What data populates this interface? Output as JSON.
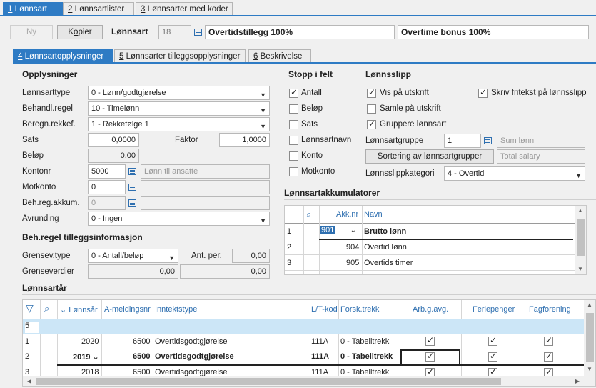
{
  "top_tabs": [
    {
      "num": "1",
      "label": " Lønnsart"
    },
    {
      "num": "2",
      "label": " Lønnsartlister"
    },
    {
      "num": "3",
      "label": " Lønnsarter med koder"
    }
  ],
  "header": {
    "new_label": "Ny",
    "copy_label": "Kopier",
    "copy_mnemonic": "o",
    "lonnsart_label": "Lønnsart",
    "lonnsart_id": "18",
    "name_no": "Overtidstillegg 100%",
    "name_en": "Overtime bonus 100%"
  },
  "sub_tabs": [
    {
      "num": "4",
      "label": " Lønnsartopplysninger"
    },
    {
      "num": "5",
      "label": " Lønnsarter tilleggsopplysninger"
    },
    {
      "num": "6",
      "label": " Beskrivelse"
    }
  ],
  "opplysninger": {
    "title": "Opplysninger",
    "lonnsarttype_label": "Lønnsarttype",
    "lonnsarttype_value": "0 - Lønn/godtgjørelse",
    "behandl_label": "Behandl.regel",
    "behandl_value": "10 - Timelønn",
    "beregn_label": "Beregn.rekkef.",
    "beregn_value": "1 - Rekkefølge 1",
    "sats_label": "Sats",
    "sats_value": "0,0000",
    "faktor_label": "Faktor",
    "faktor_value": "1,0000",
    "belop_label": "Beløp",
    "belop_value": "0,00",
    "kontonr_label": "Kontonr",
    "kontonr_value": "5000",
    "kontonr_desc": "Lønn til ansatte",
    "motkonto_label": "Motkonto",
    "motkonto_value": "0",
    "behreg_label": "Beh.reg.akkum.",
    "behreg_value": "0",
    "avrunding_label": "Avrunding",
    "avrunding_value": "0 - Ingen"
  },
  "behregel_info": {
    "title": "Beh.regel tilleggsinformasjon",
    "grensev_label": "Grensev.type",
    "grensev_value": "0 - Antall/beløp",
    "antper_label": "Ant. per.",
    "antper_value": "0,00",
    "grenseverdier_label": "Grenseverdier",
    "grense1": "0,00",
    "grense2": "0,00"
  },
  "stopp": {
    "title": "Stopp i felt",
    "items": [
      {
        "label": "Antall",
        "checked": true
      },
      {
        "label": "Beløp",
        "checked": false
      },
      {
        "label": "Sats",
        "checked": false
      },
      {
        "label": "Lønnsartnavn",
        "checked": false
      },
      {
        "label": "Konto",
        "checked": false
      },
      {
        "label": "Motkonto",
        "checked": false
      }
    ]
  },
  "lonnsslipp": {
    "title": "Lønnsslipp",
    "vis_label": "Vis på utskrift",
    "skriv_label": "Skriv fritekst på lønnsslipp",
    "samle_label": "Samle på utskrift",
    "gruppere_label": "Gruppere lønnsart",
    "gruppe_label": "Lønnsartgruppe",
    "gruppe_value": "1",
    "gruppe_desc": "Sum lønn",
    "sortering_label": "Sortering av lønnsartgrupper",
    "total_desc": "Total salary",
    "kategori_label": "Lønnsslippkategori",
    "kategori_value": "4 - Overtid"
  },
  "akkumulatorer": {
    "title": "Lønnsartakkumulatorer",
    "col_akknr": "Akk.nr",
    "col_navn": "Navn",
    "rows": [
      {
        "n": "1",
        "akk": "901",
        "navn": "Brutto lønn"
      },
      {
        "n": "2",
        "akk": "904",
        "navn": "Overtid lønn"
      },
      {
        "n": "3",
        "akk": "905",
        "navn": "Overtids timer"
      }
    ]
  },
  "lonnsartar": {
    "title": "Lønnsartår",
    "cols": [
      "Lønnsår",
      "A-meldingsnr",
      "Inntektstype",
      "L/T-kod",
      "Forsk.trekk",
      "Arb.g.avg.",
      "Feriepenger",
      "Fagforening"
    ],
    "new_row_num": "5",
    "rows": [
      {
        "n": "1",
        "year": "2020",
        "amelding": "6500",
        "type": "Overtidsgodtgjørelse",
        "lt": "111A",
        "forsk": "0 - Tabelltrekk"
      },
      {
        "n": "2",
        "year": "2019",
        "amelding": "6500",
        "type": "Overtidsgodtgjørelse",
        "lt": "111A",
        "forsk": "0 - Tabelltrekk"
      },
      {
        "n": "3",
        "year": "2018",
        "amelding": "6500",
        "type": "Overtidsgodtgjørelse",
        "lt": "111A",
        "forsk": "0 - Tabelltrekk"
      }
    ]
  },
  "colors": {
    "accent": "#2e7bc4",
    "selection": "#cce6f7"
  }
}
